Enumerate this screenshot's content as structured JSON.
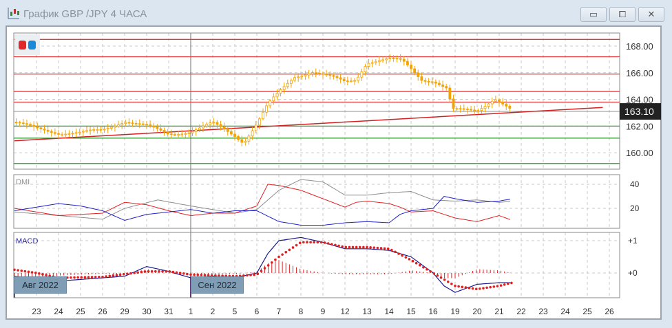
{
  "window": {
    "title": "График GBP /JPY  4 ЧАСА",
    "minimize": "▭",
    "restore": "⧠",
    "close": "✕"
  },
  "colors": {
    "candle": "#f5a300",
    "resistance": "#e03a3a",
    "support": "#2a9a2a",
    "trend": "#d42020",
    "adx": "#8c8c8c",
    "plus_di": "#e02020",
    "minus_di": "#2020c8",
    "macd": "#1a1a8c",
    "signal": "#e02020"
  },
  "legend": {
    "red": "#e02a2a",
    "blue": "#1a8ad8"
  },
  "price_axis": {
    "ticks": [
      "168.00",
      "166.00",
      "164.00",
      "162.00",
      "160.00"
    ],
    "current": "163.10"
  },
  "dmi": {
    "label": "DMI",
    "ticks": [
      "40",
      "20"
    ]
  },
  "macd": {
    "label": "MACD",
    "ticks": [
      "+1",
      "+0"
    ]
  },
  "periods": [
    "Авг 2022",
    "Сен 2022"
  ],
  "x_labels": [
    "23",
    "24",
    "25",
    "26",
    "29",
    "30",
    "31",
    "1",
    "2",
    "5",
    "6",
    "7",
    "8",
    "9",
    "12",
    "13",
    "14",
    "15",
    "16",
    "19",
    "20",
    "21",
    "22",
    "23",
    "24",
    "25",
    "26"
  ],
  "chart_data": {
    "type": "line",
    "price_levels": {
      "resistance": [
        168.5,
        167.2,
        165.9,
        164.6,
        163.8
      ],
      "support": [
        162.0,
        161.1,
        159.2
      ]
    },
    "trendline": [
      [
        0,
        160.9
      ],
      [
        26.7,
        163.4
      ]
    ],
    "price_path": [
      [
        0,
        162.3
      ],
      [
        1,
        161.8
      ],
      [
        2,
        161.5
      ],
      [
        3,
        161.5
      ],
      [
        4,
        161.7
      ],
      [
        5,
        162.4
      ],
      [
        6,
        162.0
      ],
      [
        7,
        161.4
      ],
      [
        8,
        161.6
      ],
      [
        9,
        162.2
      ],
      [
        10,
        161.3
      ],
      [
        10.4,
        160.8
      ],
      [
        11,
        162.2
      ],
      [
        11.5,
        163.6
      ],
      [
        12,
        164.5
      ],
      [
        12.7,
        165.7
      ],
      [
        13.5,
        166.1
      ],
      [
        14.5,
        165.6
      ],
      [
        15,
        165.3
      ],
      [
        15.5,
        165.5
      ],
      [
        16,
        166.8
      ],
      [
        17,
        167.0
      ],
      [
        17.6,
        166.9
      ],
      [
        18,
        166.3
      ],
      [
        18.5,
        165.5
      ],
      [
        19,
        165.4
      ],
      [
        19.6,
        164.8
      ],
      [
        19.9,
        163.2
      ],
      [
        21,
        163.2
      ],
      [
        21.8,
        164.1
      ],
      [
        22.2,
        163.6
      ],
      [
        22.6,
        163.1
      ]
    ],
    "dmi_adx": [
      [
        0,
        17
      ],
      [
        2,
        14
      ],
      [
        4,
        11
      ],
      [
        5,
        20
      ],
      [
        6.5,
        27
      ],
      [
        8,
        22
      ],
      [
        10,
        16
      ],
      [
        11,
        19
      ],
      [
        12,
        35
      ],
      [
        13,
        44
      ],
      [
        14,
        42
      ],
      [
        15,
        31
      ],
      [
        16,
        31
      ],
      [
        17,
        33
      ],
      [
        18,
        34
      ],
      [
        19,
        27
      ],
      [
        20,
        26
      ],
      [
        21,
        27
      ],
      [
        22,
        25
      ],
      [
        22.6,
        26
      ]
    ],
    "dmi_plus": [
      [
        0,
        20
      ],
      [
        1,
        17
      ],
      [
        2,
        14
      ],
      [
        3,
        15
      ],
      [
        4,
        16
      ],
      [
        5,
        25
      ],
      [
        6,
        23
      ],
      [
        7,
        18
      ],
      [
        8,
        14
      ],
      [
        9,
        16
      ],
      [
        10,
        16
      ],
      [
        11,
        22
      ],
      [
        11.5,
        40
      ],
      [
        12,
        39
      ],
      [
        13,
        35
      ],
      [
        14,
        28
      ],
      [
        15,
        21
      ],
      [
        15.5,
        25
      ],
      [
        16,
        26
      ],
      [
        17,
        24
      ],
      [
        17.5,
        21
      ],
      [
        18,
        17
      ],
      [
        19,
        18
      ],
      [
        20,
        12
      ],
      [
        21,
        9
      ],
      [
        22,
        14
      ],
      [
        22.6,
        10
      ]
    ],
    "dmi_minus": [
      [
        0,
        18
      ],
      [
        1,
        21
      ],
      [
        2,
        24
      ],
      [
        3,
        22
      ],
      [
        4,
        18
      ],
      [
        5,
        10
      ],
      [
        6,
        15
      ],
      [
        7,
        17
      ],
      [
        8,
        19
      ],
      [
        9,
        16
      ],
      [
        10,
        18
      ],
      [
        11,
        18
      ],
      [
        12,
        9
      ],
      [
        13,
        6
      ],
      [
        14,
        6
      ],
      [
        15,
        8
      ],
      [
        16,
        9
      ],
      [
        17,
        8
      ],
      [
        17.5,
        15
      ],
      [
        18,
        18
      ],
      [
        19,
        20
      ],
      [
        19.5,
        30
      ],
      [
        20,
        28
      ],
      [
        21,
        25
      ],
      [
        22,
        26
      ],
      [
        22.6,
        28
      ]
    ],
    "macd_line": [
      [
        0,
        -0.1
      ],
      [
        2,
        -0.25
      ],
      [
        3,
        -0.2
      ],
      [
        5,
        -0.1
      ],
      [
        6,
        0.2
      ],
      [
        7,
        0.05
      ],
      [
        8,
        -0.15
      ],
      [
        9,
        -0.1
      ],
      [
        10,
        -0.15
      ],
      [
        11,
        0
      ],
      [
        11.5,
        0.6
      ],
      [
        12,
        1.0
      ],
      [
        13,
        1.1
      ],
      [
        14,
        0.95
      ],
      [
        15,
        0.75
      ],
      [
        16,
        0.75
      ],
      [
        17,
        0.7
      ],
      [
        18,
        0.5
      ],
      [
        19,
        0
      ],
      [
        19.5,
        -0.4
      ],
      [
        20,
        -0.6
      ],
      [
        21,
        -0.35
      ],
      [
        22,
        -0.3
      ],
      [
        22.6,
        -0.3
      ]
    ],
    "macd_signal": [
      [
        0,
        0.1
      ],
      [
        1,
        0
      ],
      [
        2,
        -0.15
      ],
      [
        4,
        -0.12
      ],
      [
        6,
        0.05
      ],
      [
        7,
        0.05
      ],
      [
        8,
        -0.05
      ],
      [
        10,
        -0.1
      ],
      [
        11,
        -0.05
      ],
      [
        12,
        0.5
      ],
      [
        13,
        0.95
      ],
      [
        14,
        0.95
      ],
      [
        15,
        0.8
      ],
      [
        16,
        0.8
      ],
      [
        17,
        0.75
      ],
      [
        18,
        0.4
      ],
      [
        19,
        0
      ],
      [
        20,
        -0.4
      ],
      [
        21,
        -0.5
      ],
      [
        22,
        -0.4
      ],
      [
        22.6,
        -0.3
      ]
    ]
  }
}
